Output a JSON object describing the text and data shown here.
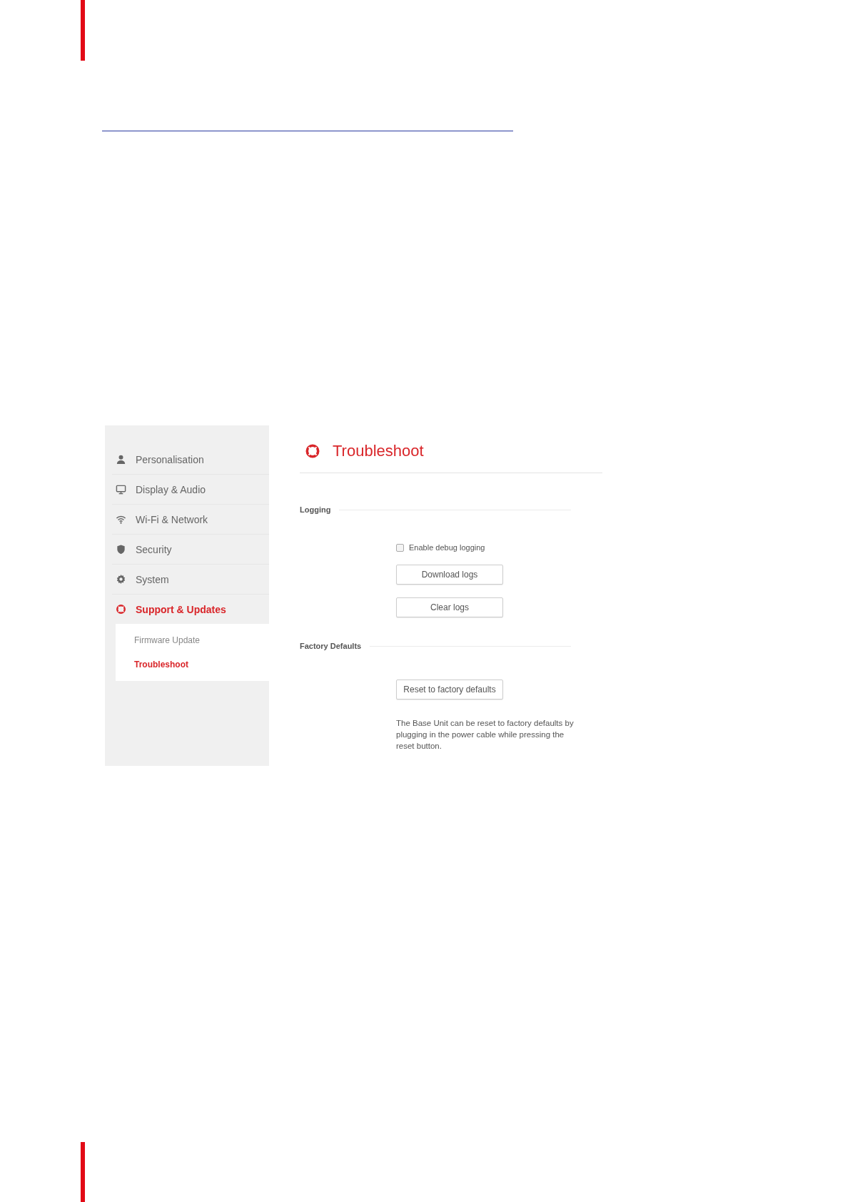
{
  "sidebar": {
    "items": [
      {
        "label": "Personalisation",
        "kind": "person",
        "selected": false
      },
      {
        "label": "Display & Audio",
        "kind": "monitor",
        "selected": false
      },
      {
        "label": "Wi-Fi & Network",
        "kind": "wifi",
        "selected": false
      },
      {
        "label": "Security",
        "kind": "shield",
        "selected": false
      },
      {
        "label": "System",
        "kind": "gear",
        "selected": false
      },
      {
        "label": "Support & Updates",
        "kind": "lifebuoy",
        "selected": true,
        "children": [
          {
            "label": "Firmware Update",
            "selected": false
          },
          {
            "label": "Troubleshoot",
            "selected": true
          }
        ]
      }
    ]
  },
  "content": {
    "title": "Troubleshoot",
    "sections": [
      {
        "heading": "Logging",
        "controls": [
          {
            "kind": "checkbox",
            "label": "Enable debug logging",
            "checked": false
          },
          {
            "kind": "button",
            "label": "Download logs"
          },
          {
            "kind": "button",
            "label": "Clear logs"
          }
        ]
      },
      {
        "heading": "Factory Defaults",
        "controls": [
          {
            "kind": "button",
            "label": "Reset to factory defaults"
          },
          {
            "kind": "note",
            "text": "The Base Unit can be reset to factory defaults by plugging in the power cable while pressing the reset button."
          }
        ]
      }
    ]
  }
}
